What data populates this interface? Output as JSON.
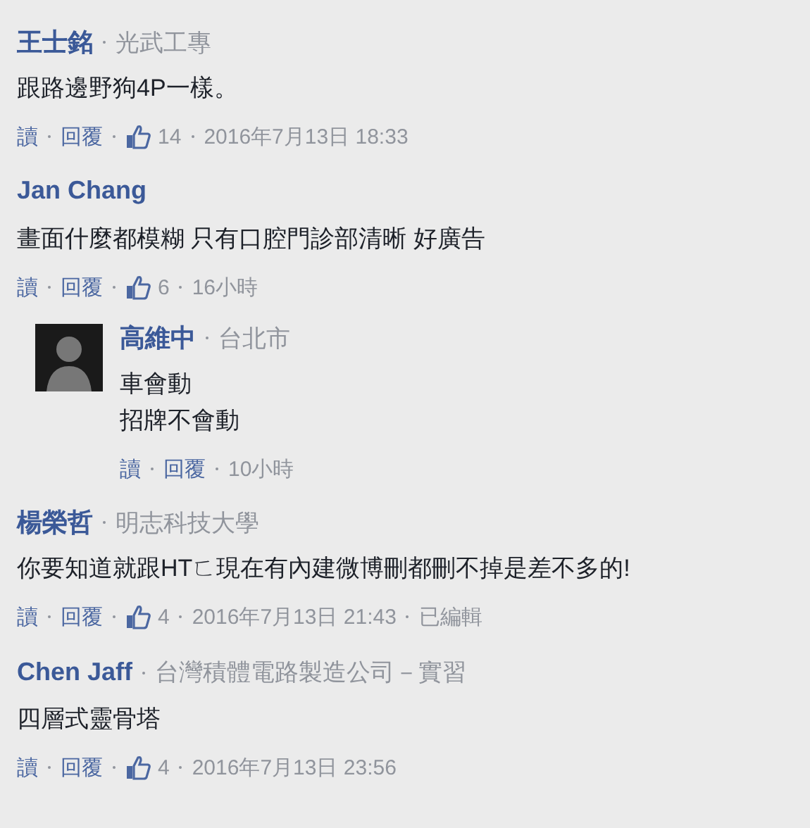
{
  "comments": [
    {
      "kind": "comment",
      "name": "王士銘",
      "affiliation": "光武工專",
      "text": [
        "跟路邊野狗4P一樣。"
      ],
      "actions": [
        "讀",
        "回覆"
      ],
      "likes": "14",
      "time": "2016年7月13日 18:33"
    },
    {
      "kind": "comment",
      "name": "Jan Chang",
      "text": [
        "畫面什麼都模糊 只有口腔門診部清晰 好廣告"
      ],
      "actions": [
        "讀",
        "回覆"
      ],
      "likes": "6",
      "time": "16小時"
    },
    {
      "kind": "reply",
      "name": "高維中",
      "affiliation": "台北市",
      "text": [
        "車會動",
        "招牌不會動"
      ],
      "actions": [
        "讀",
        "回覆"
      ],
      "time": "10小時"
    },
    {
      "kind": "comment",
      "name": "楊榮哲",
      "affiliation": "明志科技大學",
      "text": [
        "你要知道就跟HTㄈ現在有內建微博刪都刪不掉是差不多的!"
      ],
      "actions": [
        "讀",
        "回覆"
      ],
      "likes": "4",
      "time": "2016年7月13日 21:43",
      "edited": "已編輯"
    },
    {
      "kind": "comment",
      "name": "Chen Jaff",
      "affiliation": "台灣積體電路製造公司－實習",
      "text": [
        "四層式靈骨塔"
      ],
      "actions": [
        "讀",
        "回覆"
      ],
      "likes": "4",
      "time": "2016年7月13日 23:56"
    }
  ]
}
